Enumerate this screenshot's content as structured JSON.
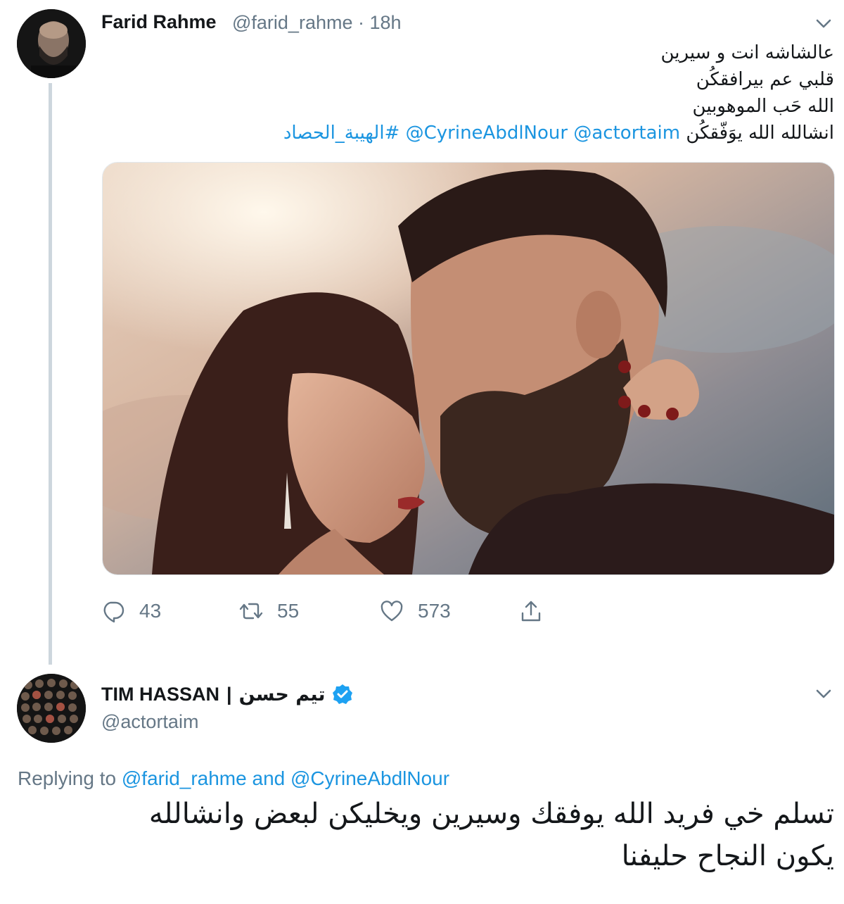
{
  "tweet1": {
    "author_name": "Farid Rahme",
    "author_handle": "@farid_rahme",
    "separator": "·",
    "time": "18h",
    "text_lines": [
      "عالشاشه انت و سيرين",
      "قلبي عم بيرافقكُن",
      "الله حَب الموهوبين"
    ],
    "line4_text": "انشالله الله يوَفّقكُن",
    "mentions": [
      "@actortaim",
      "@CyrineAbdlNour"
    ],
    "hashtag": "#الهيبة_الحصاد",
    "actions": {
      "replies": "43",
      "retweets": "55",
      "likes": "573"
    }
  },
  "tweet2": {
    "author_name_latin": "TIM HASSAN",
    "name_separator": "|",
    "author_name_arabic": "تيم حسن",
    "author_handle": "@actortaim",
    "replying_prefix": "Replying to",
    "replying_to": [
      "@farid_rahme",
      "@CyrineAbdlNour"
    ],
    "replying_and": "and",
    "text_lines": [
      "تسلم خي فريد الله يوفقك وسيرين ويخليكن لبعض وانشالله",
      "يكون النجاح حليفنا"
    ]
  },
  "icons": {
    "reply": "reply-icon",
    "retweet": "retweet-icon",
    "like": "heart-icon",
    "share": "share-icon",
    "more": "chevron-down-icon",
    "verified": "verified-badge-icon"
  },
  "colors": {
    "link": "#1b95e0",
    "muted": "#657786",
    "text": "#14171a",
    "thread_line": "#cdd6dd"
  }
}
